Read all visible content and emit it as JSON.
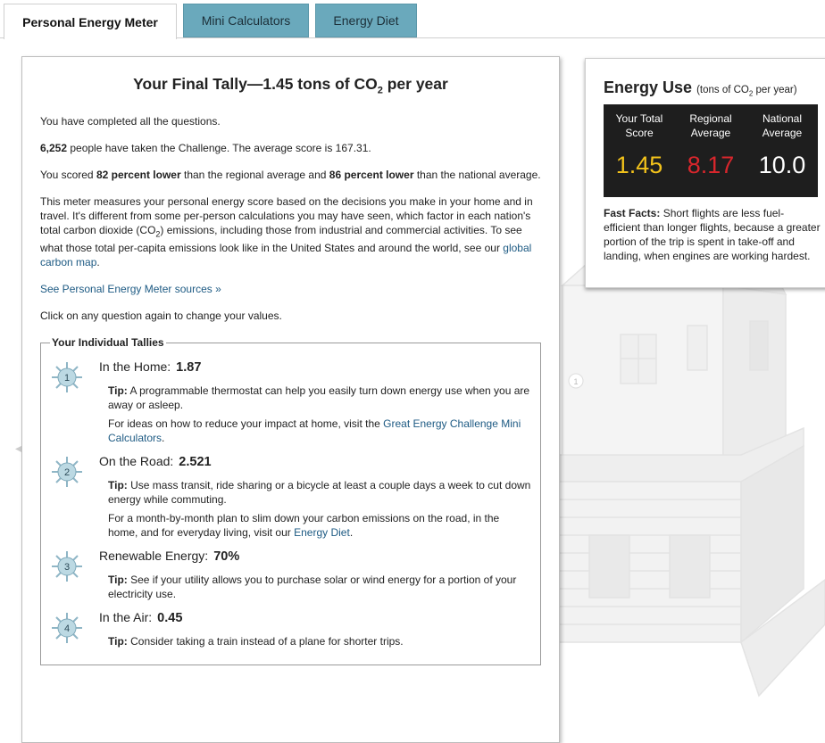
{
  "tabs": {
    "active": "Personal Energy Meter",
    "mini": "Mini Calculators",
    "diet": "Energy Diet"
  },
  "main": {
    "title_pre": "Your Final Tally—1.45 tons of CO",
    "title_sub": "2",
    "title_post": " per year",
    "completed": "You have completed all the questions.",
    "taken_count": "6,252",
    "taken_text": " people have taken the Challenge. The average score is 167.31.",
    "scored_a": "You scored ",
    "scored_b": "82 percent lower",
    "scored_c": " than the regional average and ",
    "scored_d": "86 percent lower",
    "scored_e": " than the national average.",
    "meter_text_a": "This meter measures your personal energy score based on the decisions you make in your home and in travel. It's different from some per-person calculations you may have seen, which factor in each nation's total carbon dioxide (CO",
    "meter_sub": "2",
    "meter_text_b": ") emissions, including those from industrial and commercial activities. To see what those total per-capita emissions look like in the United States and around the world, see our ",
    "meter_link": "global carbon map",
    "meter_end": ".",
    "sources_link": "See Personal Energy Meter sources »",
    "click_text": "Click on any question again to change your values."
  },
  "tallies": {
    "legend": "Your Individual Tallies",
    "tip_label": "Tip:",
    "items": [
      {
        "num": "1",
        "label": "In the Home:",
        "value": "1.87",
        "tip": " A programmable thermostat can help you easily turn down energy use when you are away or asleep.",
        "extra_a": "For ideas on how to reduce your impact at home, visit the ",
        "extra_link": "Great Energy Challenge Mini Calculators",
        "extra_b": "."
      },
      {
        "num": "2",
        "label": "On the Road:",
        "value": "2.521",
        "tip": " Use mass transit, ride sharing or a bicycle at least a couple days a week to cut down energy while commuting.",
        "extra_a": "For a month-by-month plan to slim down your carbon emissions on the road, in the home, and for everyday living, visit our ",
        "extra_link": "Energy Diet",
        "extra_b": "."
      },
      {
        "num": "3",
        "label": "Renewable Energy:",
        "value": "70%",
        "tip": " See if your utility allows you to purchase solar or wind energy for a portion of your electricity use."
      },
      {
        "num": "4",
        "label": "In the Air:",
        "value": "0.45",
        "tip": " Consider taking a train instead of a plane for shorter trips."
      }
    ]
  },
  "energy_use": {
    "title": "Energy Use",
    "unit_a": "(tons of CO",
    "unit_sub": "2",
    "unit_b": " per year)",
    "cols": [
      {
        "label": "Your Total Score",
        "value": "1.45",
        "color": "#f2c21b"
      },
      {
        "label": "Regional Average",
        "value": "8.17",
        "color": "#d8262c"
      },
      {
        "label": "National Average",
        "value": "10.0",
        "color": "#ffffff"
      }
    ],
    "facts_label": "Fast Facts:",
    "facts_text": " Short flights are less fuel-efficient than longer flights, because a greater portion of the trip is spent in take-off and landing, when engines are working hardest."
  },
  "house_badge": "1"
}
